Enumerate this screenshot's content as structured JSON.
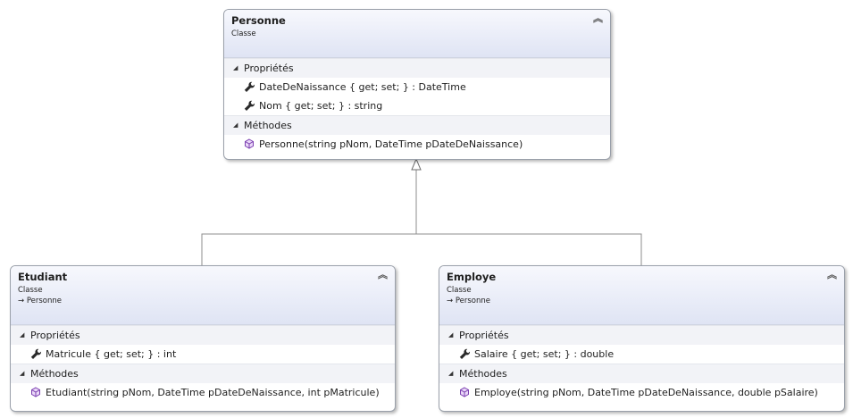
{
  "personne": {
    "name": "Personne",
    "stereotype": "Classe",
    "properties_label": "Propriétés",
    "properties": [
      "DateDeNaissance { get; set; } : DateTime",
      "Nom { get; set; } : string"
    ],
    "methods_label": "Méthodes",
    "methods": [
      "Personne(string pNom, DateTime pDateDeNaissance)"
    ]
  },
  "etudiant": {
    "name": "Etudiant",
    "stereotype": "Classe",
    "base": "→ Personne",
    "properties_label": "Propriétés",
    "properties": [
      "Matricule { get; set; } : int"
    ],
    "methods_label": "Méthodes",
    "methods": [
      "Etudiant(string pNom, DateTime pDateDeNaissance, int pMatricule)"
    ]
  },
  "employe": {
    "name": "Employe",
    "stereotype": "Classe",
    "base": "→ Personne",
    "properties_label": "Propriétés",
    "properties": [
      "Salaire { get; set; } : double"
    ],
    "methods_label": "Méthodes",
    "methods": [
      "Employe(string pNom, DateTime pDateDeNaissance, double pSalaire)"
    ]
  },
  "icons": {
    "collapse": "double-chevron-up-icon",
    "section_toggle": "triangle-expanded-icon",
    "property": "wrench-icon",
    "method": "method-cube-icon",
    "inheritance": "hollow-triangle-arrow-icon"
  },
  "colors": {
    "header_gradient_top": "#f7f8fd",
    "header_gradient_bottom": "#dfe4f4",
    "section_bg": "#f2f3f7",
    "border": "#9aa0aa",
    "connector": "#8c8c8c",
    "method_icon": "#7b3fb0"
  }
}
